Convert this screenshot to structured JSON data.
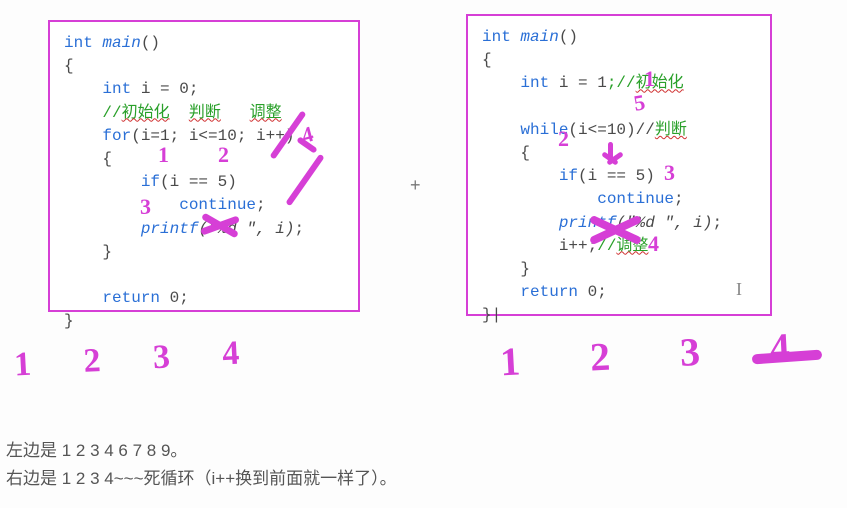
{
  "left_code": {
    "line1_pre": "int ",
    "line1_fn": "main",
    "line1_post": "()",
    "line2": "{",
    "line3_a": "    int ",
    "line3_b": "i = 0",
    "line3_c": ";",
    "line4_a": "    //",
    "line4_b": "初始化",
    "line4_c": "  ",
    "line4_d": "判断",
    "line4_e": "   ",
    "line4_f": "调整",
    "line5_a": "    for",
    "line5_b": "(i=1; i<=10; i++)",
    "line6": "    {",
    "line7_a": "        if",
    "line7_b": "(i == 5)",
    "line8_a": "            continue",
    "line8_b": ";",
    "line9_a": "        printf",
    "line9_b": "(\"%d \", i)",
    "line9_c": ";",
    "line10": "    }",
    "line11": "",
    "line12_a": "    return ",
    "line12_b": "0",
    "line12_c": ";",
    "line13": "}"
  },
  "right_code": {
    "line1_pre": "int ",
    "line1_fn": "main",
    "line1_post": "()",
    "line2": "{",
    "line3_a": "    int ",
    "line3_b": "i = 1",
    "line3_c": ";//",
    "line3_d": "初始化",
    "line4": "",
    "line5_a": "    while",
    "line5_b": "(i<=10)//",
    "line5_c": "判断",
    "line6": "    {",
    "line7_a": "        if",
    "line7_b": "(i == 5)",
    "line8_a": "            continue",
    "line8_b": ";",
    "line9_a": "        printf",
    "line9_b": "(\"%d \", i)",
    "line9_c": ";",
    "line10_a": "        i++;",
    "line10_b": "//",
    "line10_c": "调整",
    "line11": "    }",
    "line12_a": "    return ",
    "line12_b": "0",
    "line12_c": ";",
    "line13": "}|"
  },
  "plus": "+",
  "hand_left": "1 2 3 4",
  "hand_right": "1 2 3 4",
  "caption1": "左边是 1 2 3 4 6 7 8 9。",
  "caption2": "右边是 1 2 3 4~~~死循环（i++换到前面就一样了）。",
  "ann_left": {
    "a1": "1",
    "a2": "2",
    "a3": "3",
    "a4": "4"
  },
  "ann_right": {
    "a1": "1",
    "a2": "2",
    "a3": "3",
    "a4": "4",
    "a5": "5"
  },
  "cursor": "I"
}
